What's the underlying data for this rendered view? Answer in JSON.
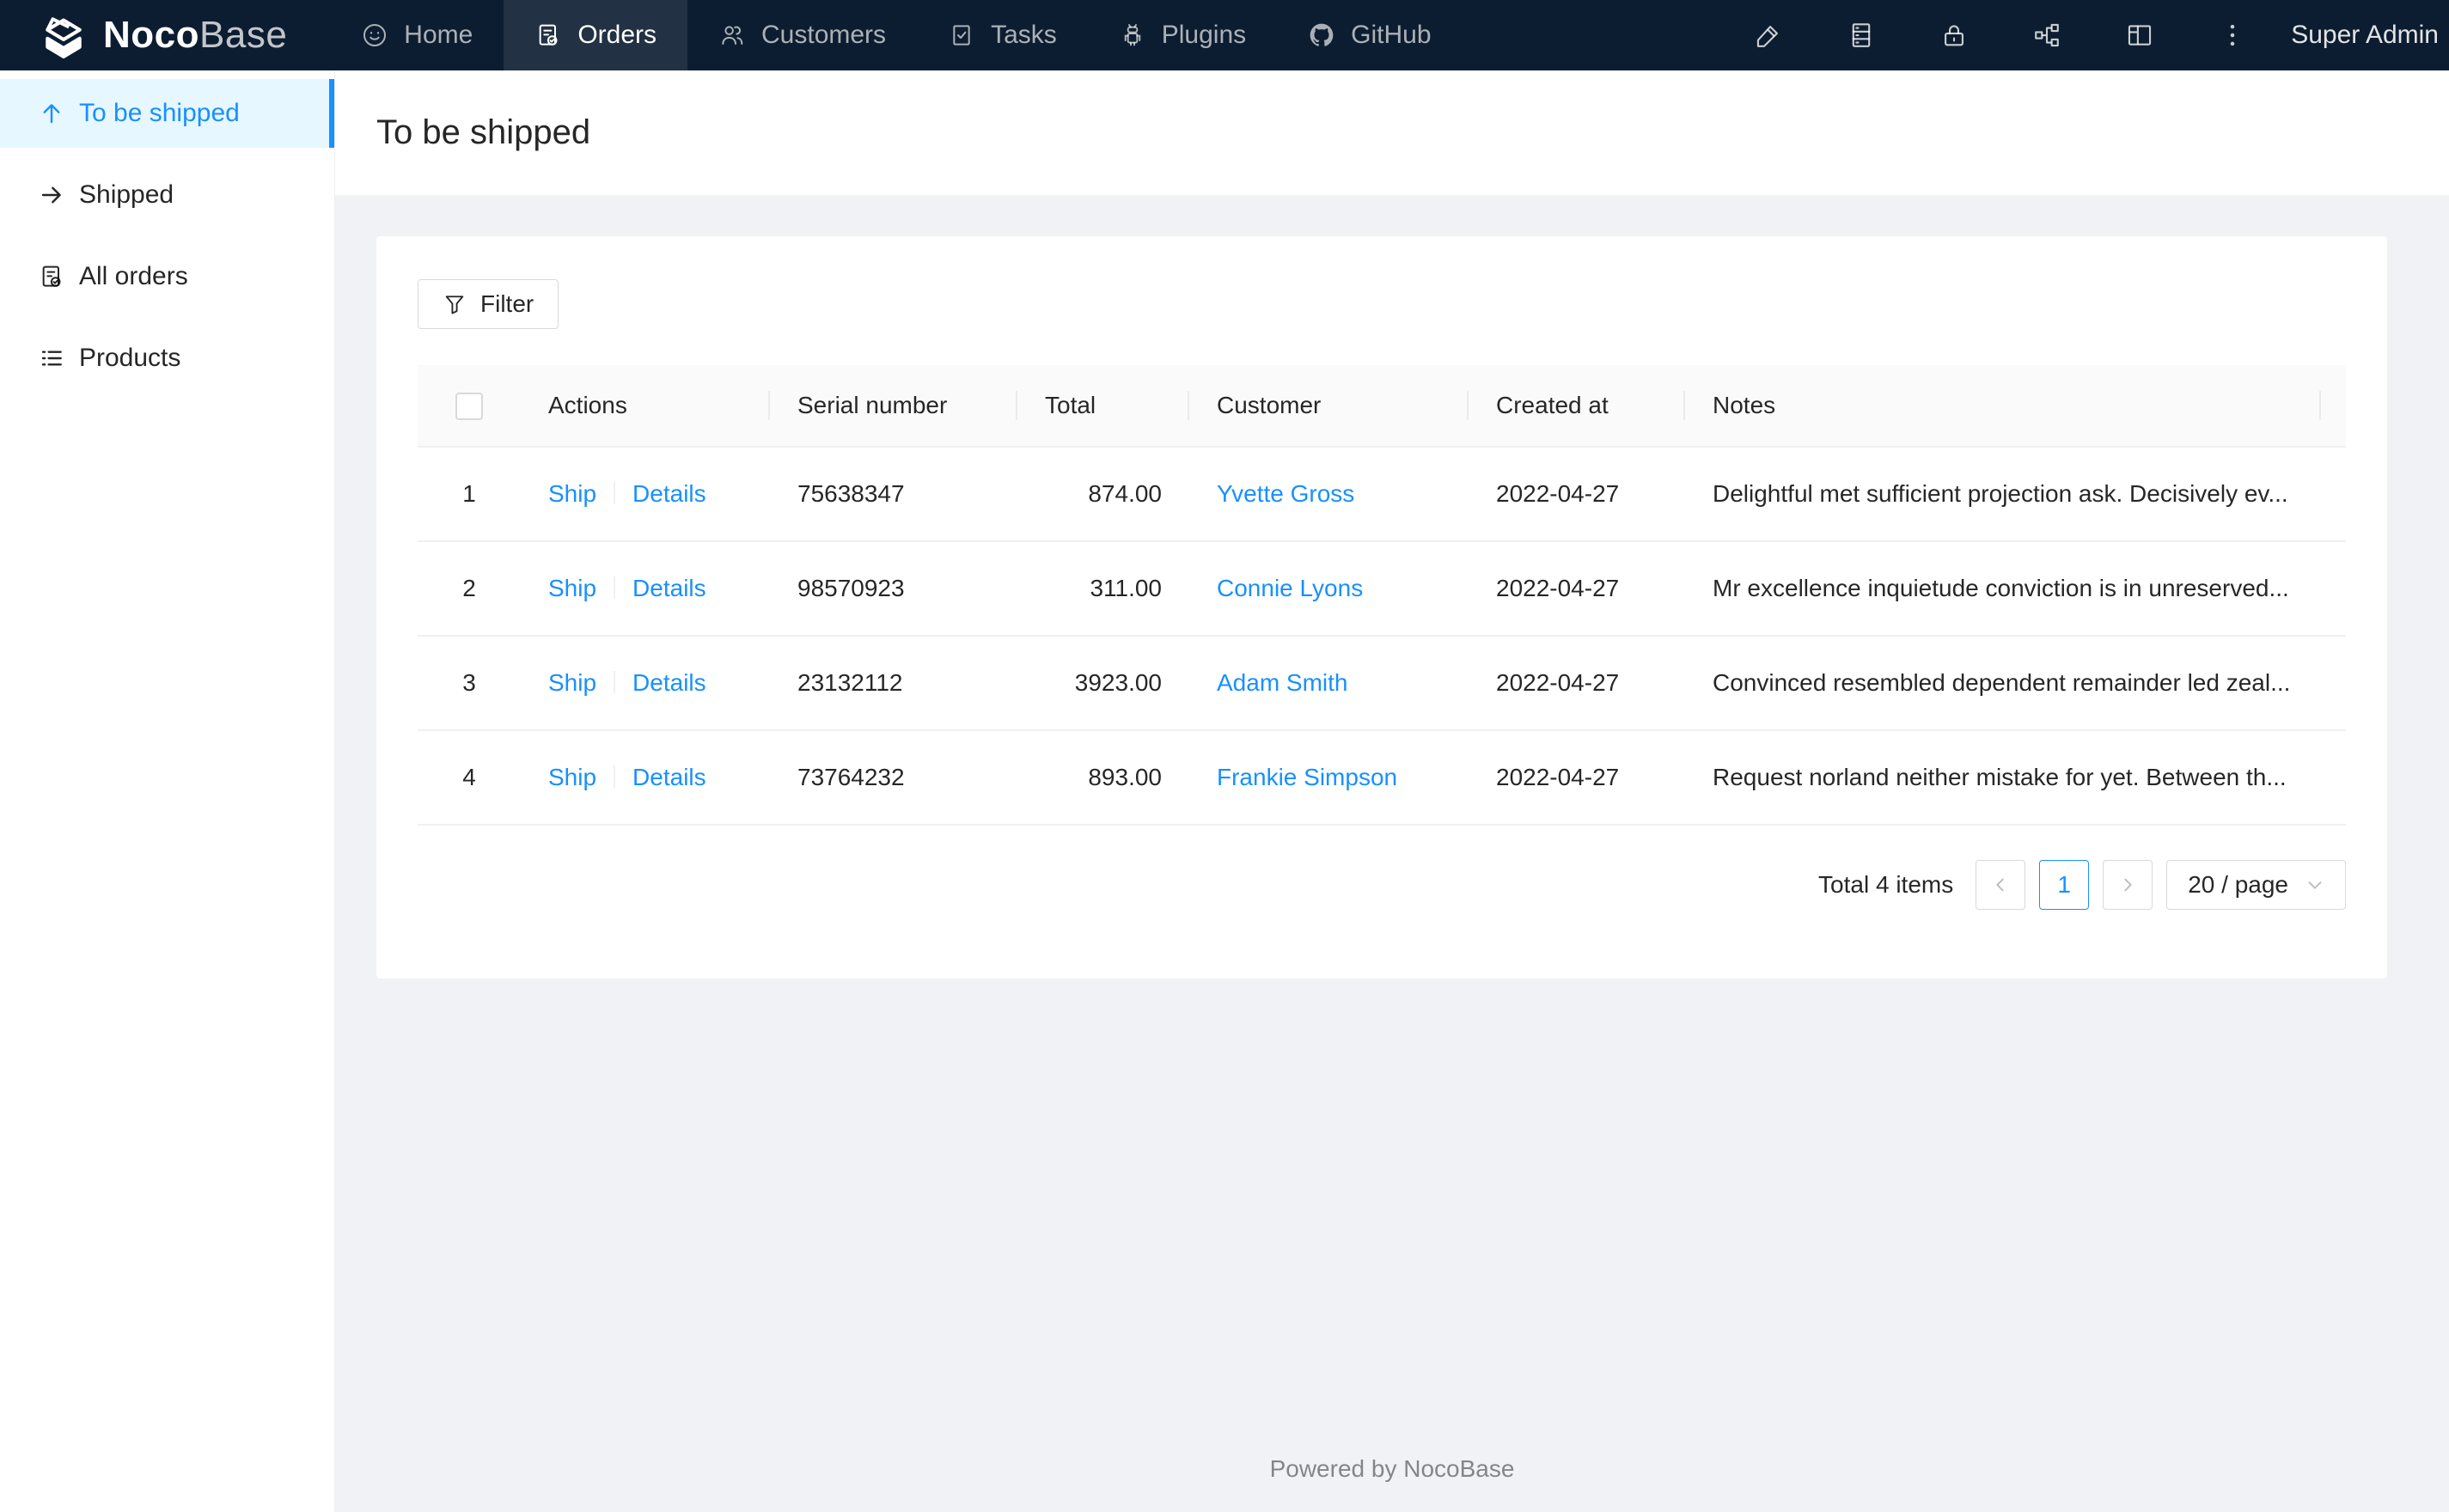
{
  "colors": {
    "accent": "#1890ff",
    "navbar_bg": "#0d1d31",
    "navbar_active_item_bg": "rgba(255,255,255,0.09)",
    "sidebar_active_bg": "#e6f7ff",
    "content_bg": "#f0f2f5",
    "link": "#1890ff",
    "border": "#f0f0f0"
  },
  "navbar": {
    "logo_bold": "Noco",
    "logo_light": "Base",
    "items": [
      {
        "label": "Home",
        "icon": "smiley-face-icon",
        "active": false
      },
      {
        "label": "Orders",
        "icon": "order-document-icon",
        "active": true
      },
      {
        "label": "Customers",
        "icon": "people-icon",
        "active": false
      },
      {
        "label": "Tasks",
        "icon": "checkbox-checked-icon",
        "active": false
      },
      {
        "label": "Plugins",
        "icon": "robot-icon",
        "active": false
      },
      {
        "label": "GitHub",
        "icon": "github-icon",
        "active": false
      }
    ],
    "right_icons": [
      "pen-icon",
      "database-icon",
      "lock-icon",
      "org-chart-icon",
      "layout-icon",
      "more-vertical-icon"
    ],
    "user": "Super Admin"
  },
  "sidebar": {
    "items": [
      {
        "label": "To be shipped",
        "icon": "arrow-up-icon",
        "active": true
      },
      {
        "label": "Shipped",
        "icon": "arrow-right-icon",
        "active": false
      },
      {
        "label": "All orders",
        "icon": "order-document-icon",
        "active": false
      },
      {
        "label": "Products",
        "icon": "list-icon",
        "active": false
      }
    ]
  },
  "page": {
    "title": "To be shipped"
  },
  "toolbar": {
    "filter_label": "Filter"
  },
  "table": {
    "columns": {
      "actions": "Actions",
      "serial": "Serial number",
      "total": "Total",
      "customer": "Customer",
      "created": "Created at",
      "notes": "Notes"
    },
    "rows": [
      {
        "index": "1",
        "ship": "Ship",
        "details": "Details",
        "serial": "75638347",
        "total": "874.00",
        "customer": "Yvette Gross",
        "created": "2022-04-27",
        "notes": "Delightful met sufficient projection ask. Decisively ev..."
      },
      {
        "index": "2",
        "ship": "Ship",
        "details": "Details",
        "serial": "98570923",
        "total": "311.00",
        "customer": "Connie Lyons",
        "created": "2022-04-27",
        "notes": "Mr excellence inquietude conviction is in unreserved..."
      },
      {
        "index": "3",
        "ship": "Ship",
        "details": "Details",
        "serial": "23132112",
        "total": "3923.00",
        "customer": "Adam Smith",
        "created": "2022-04-27",
        "notes": "Convinced resembled dependent remainder led zeal..."
      },
      {
        "index": "4",
        "ship": "Ship",
        "details": "Details",
        "serial": "73764232",
        "total": "893.00",
        "customer": "Frankie Simpson",
        "created": "2022-04-27",
        "notes": "Request norland neither mistake for yet. Between th..."
      }
    ]
  },
  "pagination": {
    "total_text": "Total 4 items",
    "current_page": "1",
    "page_size": "20 / page"
  },
  "footer": {
    "text": "Powered by NocoBase"
  }
}
